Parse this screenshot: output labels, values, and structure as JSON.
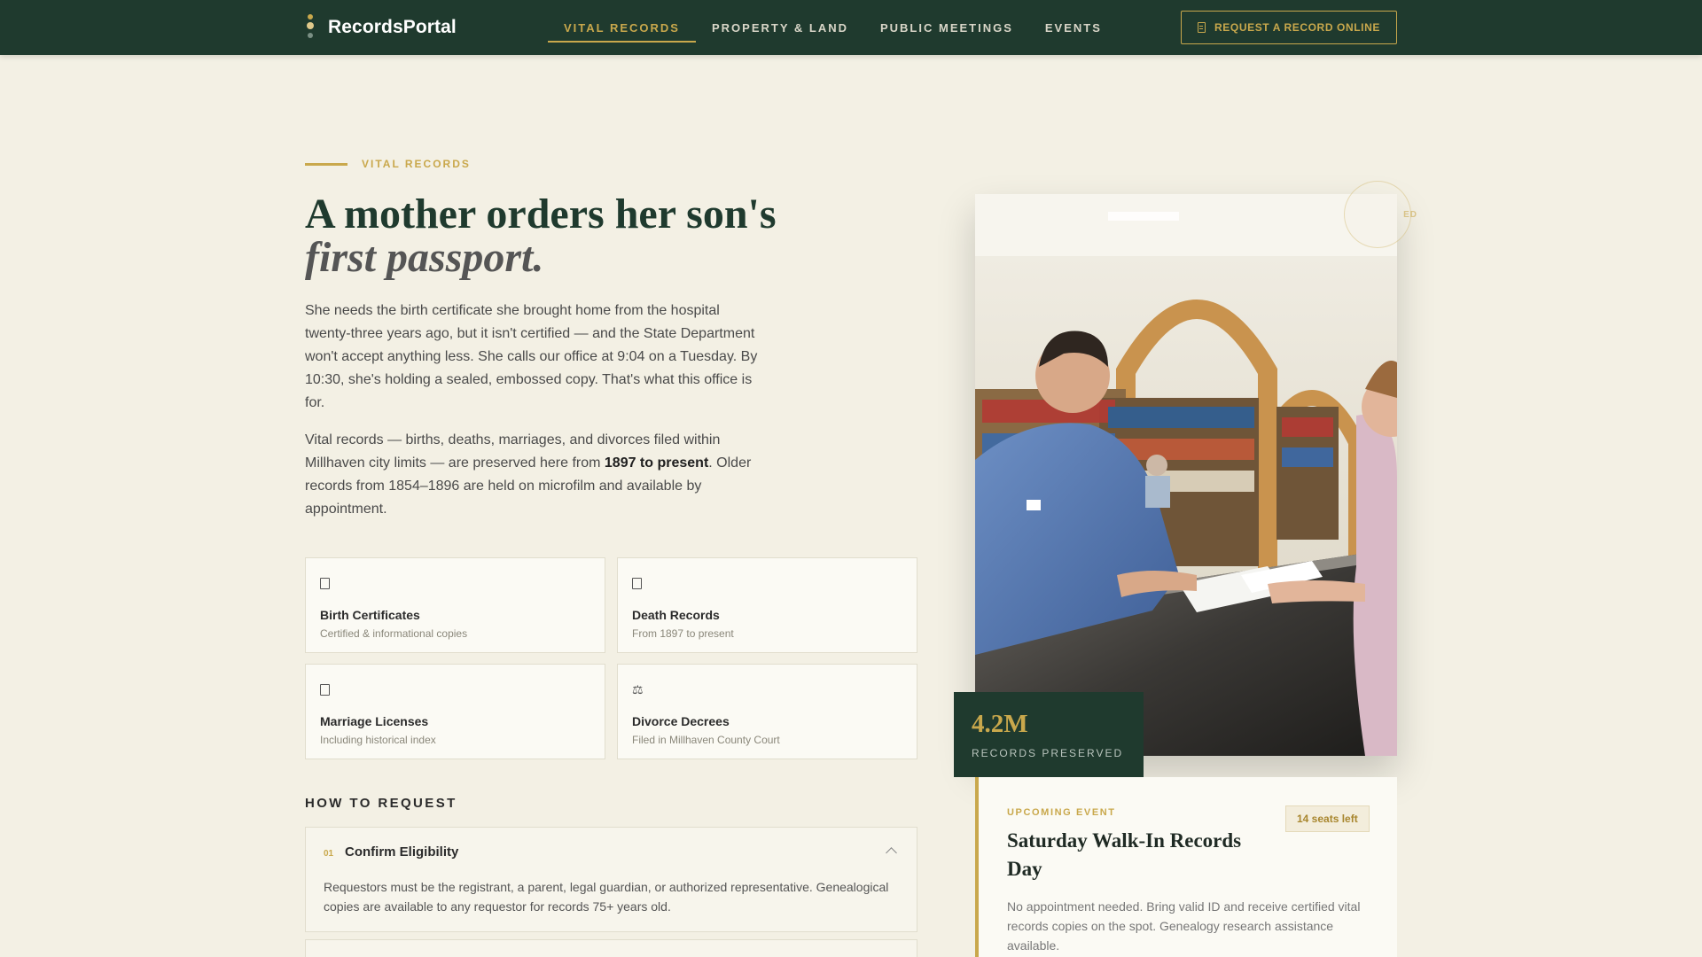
{
  "brand": {
    "name": "RecordsPortal"
  },
  "nav": {
    "items": [
      {
        "label": "VITAL RECORDS",
        "active": true
      },
      {
        "label": "PROPERTY & LAND",
        "active": false
      },
      {
        "label": "PUBLIC MEETINGS",
        "active": false
      },
      {
        "label": "EVENTS",
        "active": false
      }
    ],
    "cta_label": "REQUEST A RECORD ONLINE"
  },
  "hero": {
    "eyebrow": "VITAL RECORDS",
    "title_line1": "A mother orders her son's",
    "title_line2": "first passport.",
    "para1": "She needs the birth certificate she brought home from the hospital twenty-three years ago, but it isn't certified — and the State Department won't accept anything less. She calls our office at 9:04 on a Tuesday. By 10:30, she's holding a sealed, embossed copy. That's what this office is for.",
    "para2_before": "Vital records — births, deaths, marriages, and divorces filed within Millhaven city limits — are preserved here from ",
    "para2_bold": "1897 to present",
    "para2_after": ". Older records from 1854–1896 are held on microfilm and available by appointment."
  },
  "cards": [
    {
      "title": "Birth Certificates",
      "subtitle": "Certified & informational copies",
      "icon": "document-icon"
    },
    {
      "title": "Death Records",
      "subtitle": "From 1897 to present",
      "icon": "document-icon"
    },
    {
      "title": "Marriage Licenses",
      "subtitle": "Including historical index",
      "icon": "document-icon"
    },
    {
      "title": "Divorce Decrees",
      "subtitle": "Filed in Millhaven County Court",
      "icon": "scale-icon",
      "glyph": "⚖"
    }
  ],
  "how_to": {
    "heading": "HOW TO REQUEST",
    "steps": [
      {
        "number": "01",
        "title": "Confirm Eligibility",
        "body": "Requestors must be the registrant, a parent, legal guardian, or authorized representative. Genealogical copies are available to any requestor for records 75+ years old.",
        "expanded": true
      }
    ]
  },
  "stat": {
    "number": "4.2M",
    "label": "RECORDS PRESERVED"
  },
  "stamp": {
    "text": "ED"
  },
  "event": {
    "tag": "UPCOMING EVENT",
    "badge": "14 seats left",
    "title": "Saturday Walk-In Records Day",
    "description": "No appointment needed. Bring valid ID and receive certified vital records copies on the spot. Genealogy research assistance available."
  },
  "colors": {
    "nav_bg": "#1f3a2e",
    "accent_gold": "#c9a84c",
    "page_bg": "#f3f0e4"
  }
}
